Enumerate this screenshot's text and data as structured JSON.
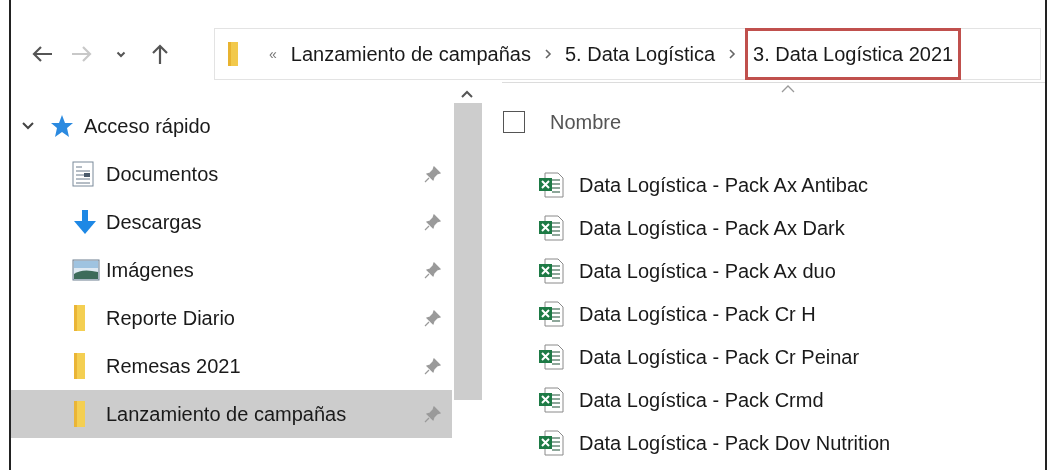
{
  "navigation": [
    {
      "kind": "back",
      "disabled": false
    },
    {
      "kind": "forward",
      "disabled": true
    },
    {
      "kind": "recent",
      "disabled": false
    },
    {
      "kind": "up",
      "disabled": false
    }
  ],
  "address_bar": {
    "overflow": "«",
    "breadcrumbs": [
      {
        "label": "Lanzamiento de campañas",
        "highlighted": false
      },
      {
        "label": "5. Data Logística",
        "highlighted": false
      },
      {
        "label": "3. Data Logística 2021",
        "highlighted": true
      }
    ]
  },
  "sidebar": {
    "group": {
      "label": "Acceso rápido",
      "expanded": true,
      "children": [
        {
          "label": "Documentos",
          "kind": "documents",
          "pinned": true,
          "selected": false
        },
        {
          "label": "Descargas",
          "kind": "downloads",
          "pinned": true,
          "selected": false
        },
        {
          "label": "Imágenes",
          "kind": "pictures",
          "pinned": true,
          "selected": false
        },
        {
          "label": "Reporte Diario",
          "kind": "folder",
          "pinned": true,
          "selected": false
        },
        {
          "label": "Remesas 2021",
          "kind": "folder",
          "pinned": true,
          "selected": false
        },
        {
          "label": "Lanzamiento de campañas",
          "kind": "folder",
          "pinned": true,
          "selected": true
        }
      ]
    }
  },
  "file_list": {
    "columns": [
      {
        "label": "Nombre",
        "sorted": true
      }
    ],
    "select_all_checked": false,
    "files": [
      {
        "name": "Data Logística - Pack Ax Antibac",
        "kind": "excel"
      },
      {
        "name": "Data Logística - Pack Ax Dark",
        "kind": "excel"
      },
      {
        "name": "Data Logística - Pack Ax duo",
        "kind": "excel"
      },
      {
        "name": "Data Logística - Pack Cr H",
        "kind": "excel"
      },
      {
        "name": "Data Logística - Pack Cr Peinar",
        "kind": "excel"
      },
      {
        "name": "Data Logística - Pack Crmd",
        "kind": "excel"
      },
      {
        "name": "Data Logística - Pack Dov Nutrition",
        "kind": "excel"
      }
    ]
  }
}
